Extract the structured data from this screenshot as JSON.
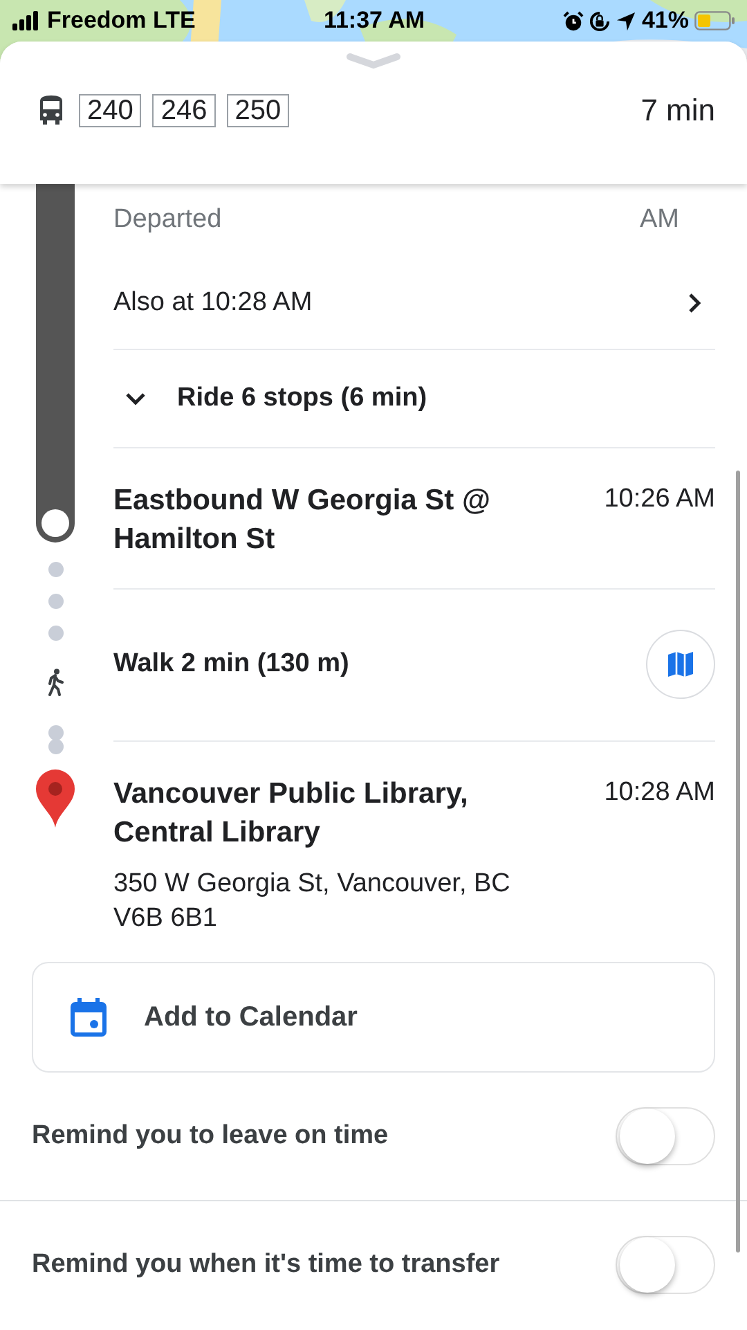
{
  "status_bar": {
    "carrier": "Freedom LTE",
    "time": "11:37 AM",
    "battery": "41%"
  },
  "header": {
    "routes": [
      "240",
      "246",
      "250"
    ],
    "duration": "7 min"
  },
  "departure": {
    "status": "Departed",
    "time_part": "AM"
  },
  "also_at": {
    "label": "Also at 10:28 AM"
  },
  "ride": {
    "label": "Ride 6 stops (6 min)",
    "expanded": false
  },
  "transfer_stop": {
    "name": "Eastbound W Georgia St @ Hamilton St",
    "time": "10:26 AM"
  },
  "walk": {
    "label": "Walk 2 min (130 m)"
  },
  "destination": {
    "name": "Vancouver Public Library, Central Library",
    "time": "10:28 AM",
    "address": "350 W Georgia St, Vancouver, BC V6B 6B1"
  },
  "calendar_button": {
    "label": "Add to Calendar"
  },
  "reminders": [
    {
      "label": "Remind you to leave on time",
      "on": false
    },
    {
      "label": "Remind you when it's time to transfer",
      "on": false
    }
  ]
}
